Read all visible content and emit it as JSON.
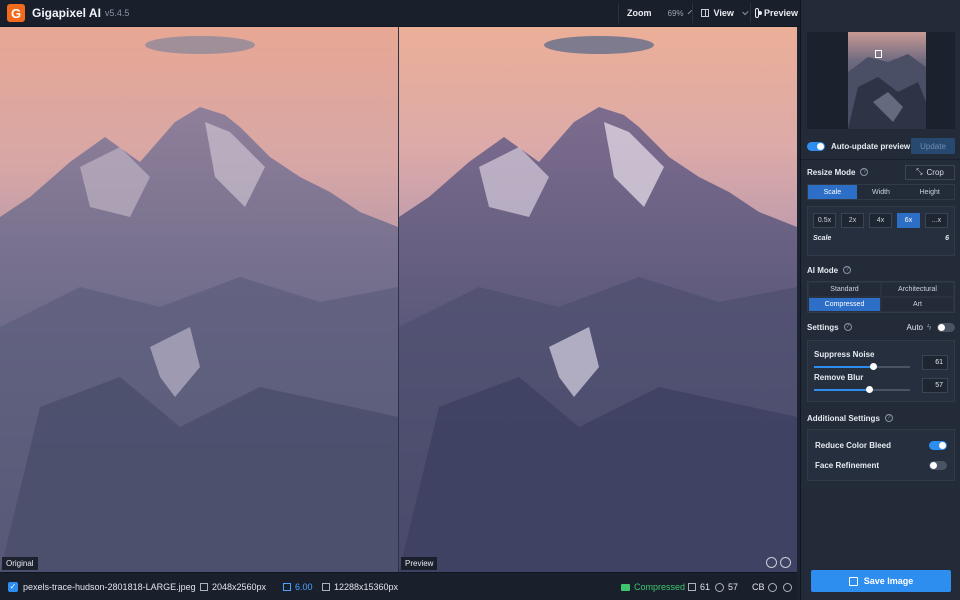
{
  "app": {
    "title": "Gigapixel AI",
    "version": "v5.4.5",
    "logo_letter": "G"
  },
  "toolbar": {
    "zoom_label": "Zoom",
    "zoom_value": "69%",
    "view_label": "View",
    "preview_label": "Preview"
  },
  "panes": {
    "left_label": "Original",
    "right_label": "Preview"
  },
  "statusbar": {
    "filename": "pexels-trace-hudson-2801818-LARGE.jpeg",
    "input_size": "2048x2560px",
    "scale": "6.00",
    "output_size": "12288x15360px",
    "mode": "Compressed",
    "noise_value": "61",
    "blur_value": "57",
    "cb_label": "CB"
  },
  "sidebar": {
    "auto_update_label": "Auto-update preview",
    "auto_update_on": true,
    "update_button": "Update",
    "resize_mode_title": "Resize Mode",
    "crop_label": "Crop",
    "resize_tabs": [
      "Scale",
      "Width",
      "Height"
    ],
    "resize_active": 0,
    "scale_options": [
      "0.5x",
      "2x",
      "4x",
      "6x",
      "...x"
    ],
    "scale_active": 3,
    "scale_label": "Scale",
    "scale_value": "6",
    "ai_mode_title": "AI Mode",
    "ai_modes": [
      "Standard",
      "Architectural",
      "Compressed",
      "Art"
    ],
    "ai_mode_active": 2,
    "settings_title": "Settings",
    "auto_label": "Auto",
    "suppress_noise_label": "Suppress Noise",
    "suppress_noise_value": "61",
    "suppress_noise_level": 0.61,
    "remove_blur_label": "Remove Blur",
    "remove_blur_value": "57",
    "remove_blur_level": 0.57,
    "additional_title": "Additional Settings",
    "reduce_color_bleed_label": "Reduce Color Bleed",
    "reduce_color_bleed_on": true,
    "face_refinement_label": "Face Refinement",
    "face_refinement_on": false,
    "save_label": "Save Image"
  }
}
